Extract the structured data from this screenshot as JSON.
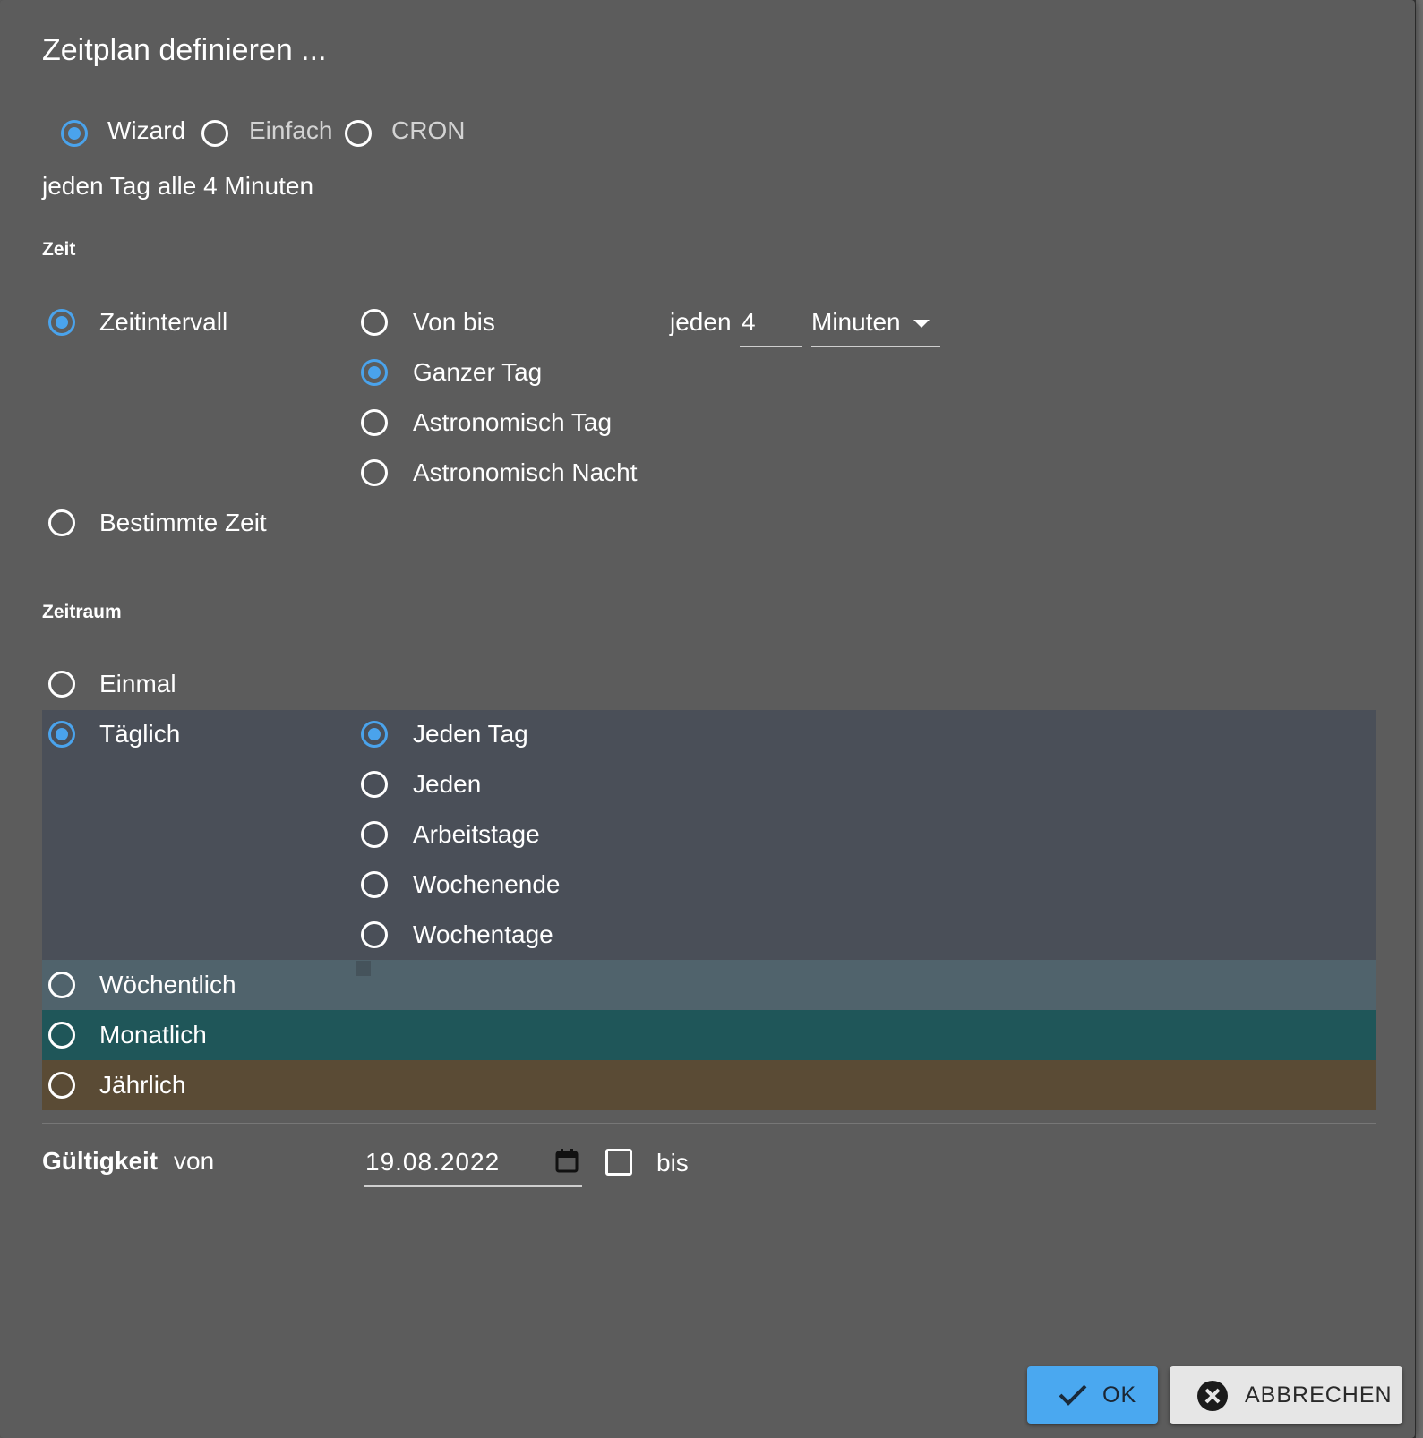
{
  "dialog": {
    "title": "Zeitplan definieren ..."
  },
  "mode": {
    "options": [
      {
        "label": "Wizard",
        "checked": true
      },
      {
        "label": "Einfach",
        "checked": false
      },
      {
        "label": "CRON",
        "checked": false
      }
    ]
  },
  "summary": "jeden Tag alle 4 Minuten",
  "zeit": {
    "heading": "Zeit",
    "type_options": [
      {
        "label": "Zeitintervall",
        "checked": true
      },
      {
        "label": "Bestimmte Zeit",
        "checked": false
      }
    ],
    "range_options": [
      {
        "label": "Von bis",
        "checked": false
      },
      {
        "label": "Ganzer Tag",
        "checked": true
      },
      {
        "label": "Astronomisch Tag",
        "checked": false
      },
      {
        "label": "Astronomisch Nacht",
        "checked": false
      }
    ],
    "interval_prefix": "jeden",
    "interval_value": "4",
    "interval_unit": "Minuten"
  },
  "zeitraum": {
    "heading": "Zeitraum",
    "period_options": [
      {
        "label": "Einmal",
        "checked": false
      },
      {
        "label": "Täglich",
        "checked": true
      },
      {
        "label": "Wöchentlich",
        "checked": false
      },
      {
        "label": "Monatlich",
        "checked": false
      },
      {
        "label": "Jährlich",
        "checked": false
      }
    ],
    "daily_options": [
      {
        "label": "Jeden Tag",
        "checked": true
      },
      {
        "label": "Jeden",
        "checked": false
      },
      {
        "label": "Arbeitstage",
        "checked": false
      },
      {
        "label": "Wochenende",
        "checked": false
      },
      {
        "label": "Wochentage",
        "checked": false
      }
    ],
    "colors": {
      "taeglich": "#4a4f58",
      "woechentlich": "#50636c",
      "monatlich": "#1f5659",
      "jaehrlich": "#5a4b35"
    }
  },
  "validity": {
    "heading": "Gültigkeit",
    "from_label": "von",
    "from_date": "19.08.2022",
    "to_label": "bis",
    "to_checked": false
  },
  "buttons": {
    "ok_label": "OK",
    "cancel_label": "ABBRECHEN",
    "ok_color": "#4aa8f0"
  }
}
